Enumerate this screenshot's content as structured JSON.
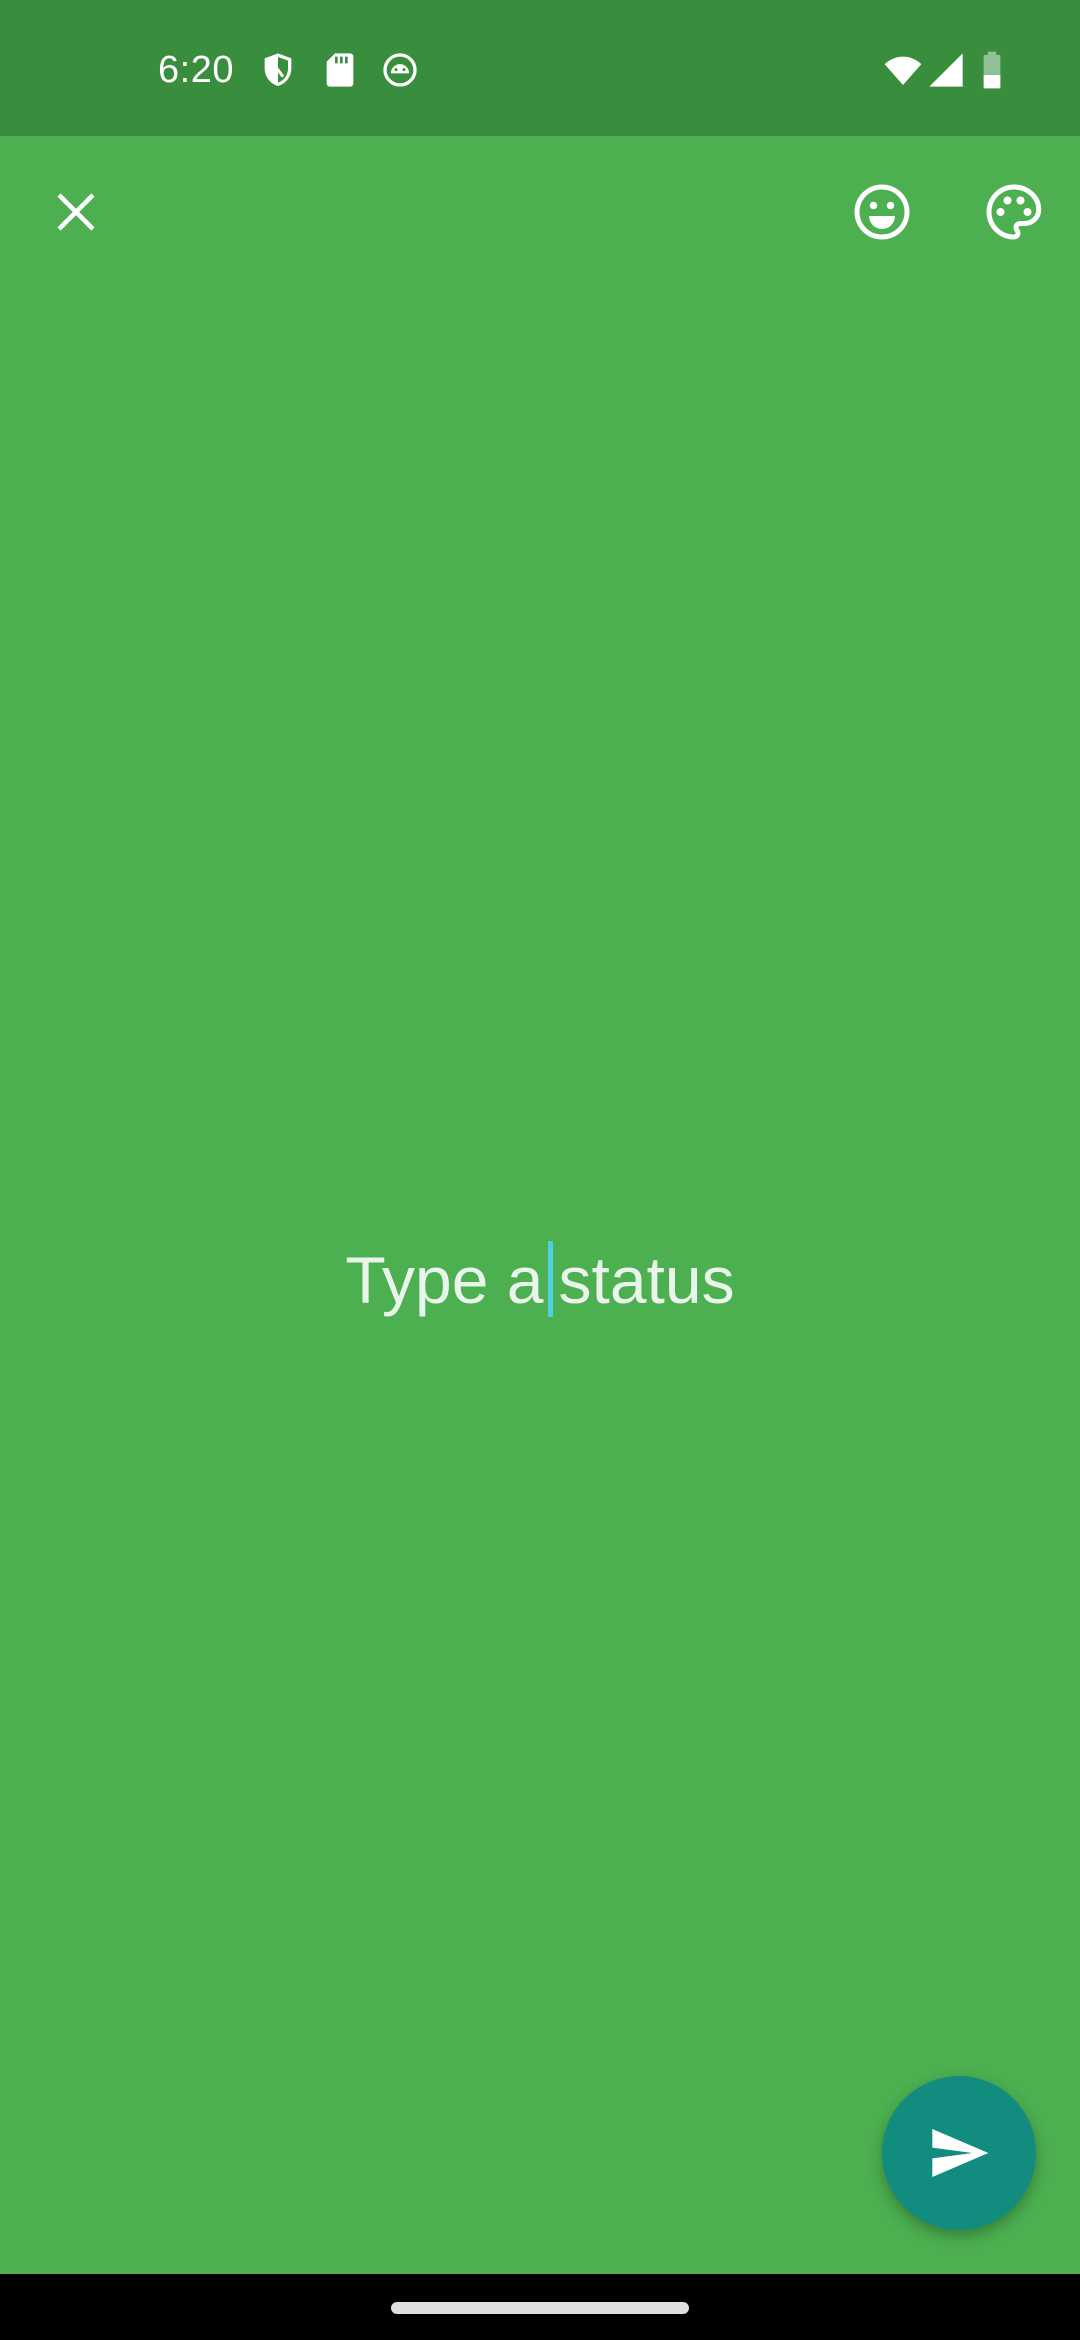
{
  "status_bar": {
    "time": "6:20",
    "icons": [
      "shield-icon",
      "sd-card-icon",
      "android-robot-icon",
      "wifi-icon",
      "cell-signal-icon",
      "battery-icon"
    ]
  },
  "app_bar": {
    "close_icon": "close-icon",
    "emoji_icon": "emoji-icon",
    "palette_icon": "palette-icon"
  },
  "composer": {
    "placeholder_before_caret": "Type a",
    "placeholder_after_caret": "status"
  },
  "send_button": {
    "icon": "send-icon"
  },
  "colors": {
    "background": "#4caf50",
    "status_bar": "#388e3c",
    "fab": "#128c7e",
    "caret": "#4dd0e1"
  }
}
